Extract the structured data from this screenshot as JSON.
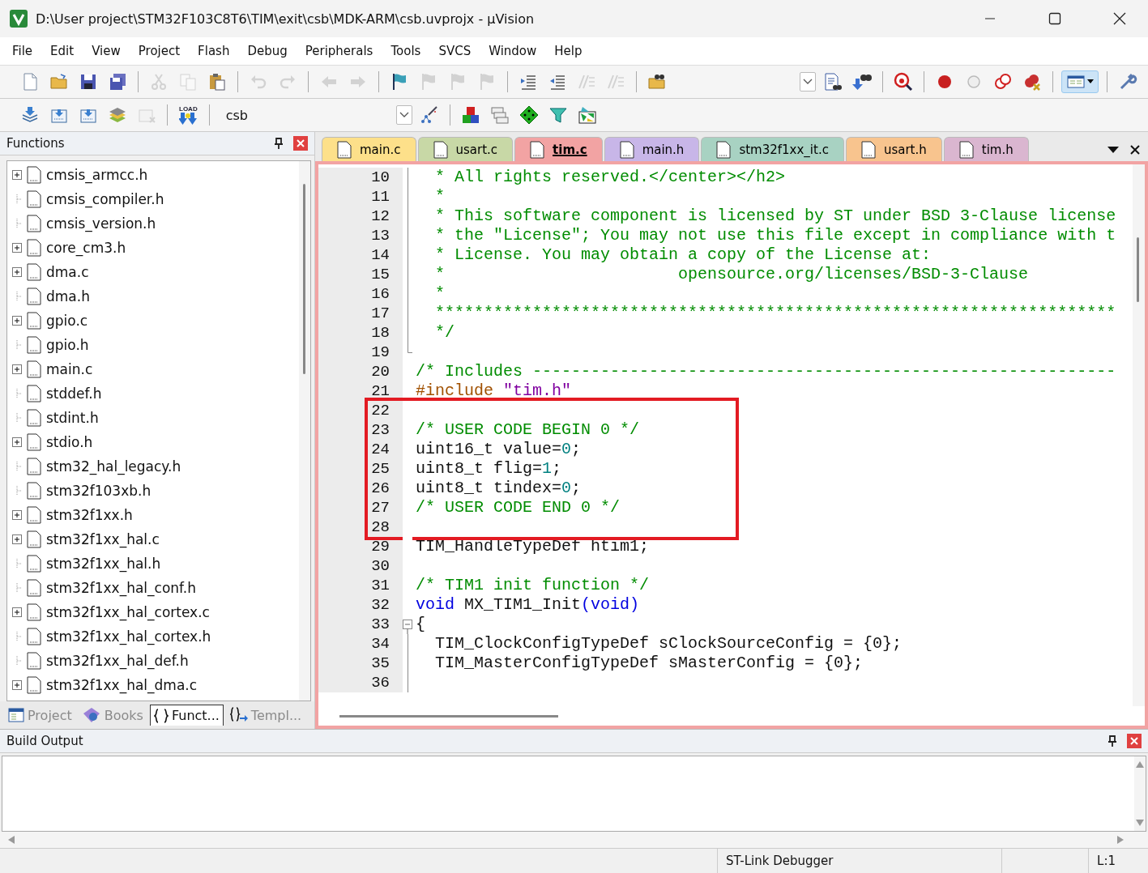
{
  "window": {
    "title": "D:\\User project\\STM32F103C8T6\\TIM\\exit\\csb\\MDK-ARM\\csb.uvprojx - µVision"
  },
  "menu": [
    "File",
    "Edit",
    "View",
    "Project",
    "Flash",
    "Debug",
    "Peripherals",
    "Tools",
    "SVCS",
    "Window",
    "Help"
  ],
  "toolbar_1": [
    {
      "kind": "new",
      "disabled": false
    },
    {
      "kind": "open",
      "disabled": false
    },
    {
      "kind": "save",
      "disabled": false
    },
    {
      "kind": "save-all",
      "disabled": false
    },
    {
      "kind": "separator"
    },
    {
      "kind": "cut",
      "disabled": true
    },
    {
      "kind": "copy",
      "disabled": true
    },
    {
      "kind": "paste",
      "disabled": false
    },
    {
      "kind": "separator"
    },
    {
      "kind": "undo",
      "disabled": true
    },
    {
      "kind": "redo",
      "disabled": true
    },
    {
      "kind": "separator"
    },
    {
      "kind": "back",
      "disabled": true
    },
    {
      "kind": "forward",
      "disabled": true
    },
    {
      "kind": "separator"
    },
    {
      "kind": "bookmark",
      "disabled": false
    },
    {
      "kind": "bookmark-prev",
      "disabled": true
    },
    {
      "kind": "bookmark-next",
      "disabled": true
    },
    {
      "kind": "bookmark-clear",
      "disabled": true
    },
    {
      "kind": "separator"
    },
    {
      "kind": "indent",
      "disabled": false
    },
    {
      "kind": "unindent",
      "disabled": false
    },
    {
      "kind": "comment",
      "disabled": true
    },
    {
      "kind": "uncomment",
      "disabled": true
    },
    {
      "kind": "separator"
    },
    {
      "kind": "find-in-files",
      "disabled": false
    },
    {
      "kind": "spacer"
    },
    {
      "kind": "combo"
    },
    {
      "kind": "find",
      "disabled": false
    },
    {
      "kind": "incremental-find",
      "disabled": false
    },
    {
      "kind": "separator"
    },
    {
      "kind": "debug",
      "disabled": false
    },
    {
      "kind": "separator"
    },
    {
      "kind": "breakpoint",
      "disabled": false
    },
    {
      "kind": "breakpoint-off",
      "disabled": false
    },
    {
      "kind": "breakpoints",
      "disabled": false
    },
    {
      "kind": "breakpoints-kill",
      "disabled": false
    },
    {
      "kind": "separator"
    },
    {
      "kind": "layout"
    },
    {
      "kind": "separator"
    },
    {
      "kind": "wrench",
      "disabled": false
    }
  ],
  "toolbar_2": [
    {
      "kind": "translate",
      "disabled": false
    },
    {
      "kind": "build",
      "disabled": false
    },
    {
      "kind": "rebuild",
      "disabled": false
    },
    {
      "kind": "batch",
      "disabled": false
    },
    {
      "kind": "stop",
      "disabled": true
    },
    {
      "kind": "separator"
    },
    {
      "kind": "load",
      "label": "LOAD"
    },
    {
      "kind": "separator"
    },
    {
      "kind": "target",
      "value": "csb"
    },
    {
      "kind": "options",
      "disabled": false
    },
    {
      "kind": "separator"
    },
    {
      "kind": "components",
      "disabled": false
    },
    {
      "kind": "multi-project",
      "disabled": false
    },
    {
      "kind": "diamond",
      "disabled": false
    },
    {
      "kind": "funnel",
      "disabled": false
    },
    {
      "kind": "packs",
      "disabled": false
    }
  ],
  "functions_panel": {
    "title": "Functions",
    "items": [
      {
        "label": "cmsis_armcc.h",
        "kind": "collapsed"
      },
      {
        "label": "cmsis_compiler.h",
        "kind": "leaf"
      },
      {
        "label": "cmsis_version.h",
        "kind": "leaf"
      },
      {
        "label": "core_cm3.h",
        "kind": "collapsed"
      },
      {
        "label": "dma.c",
        "kind": "collapsed"
      },
      {
        "label": "dma.h",
        "kind": "leaf"
      },
      {
        "label": "gpio.c",
        "kind": "collapsed"
      },
      {
        "label": "gpio.h",
        "kind": "leaf"
      },
      {
        "label": "main.c",
        "kind": "collapsed"
      },
      {
        "label": "stddef.h",
        "kind": "leaf"
      },
      {
        "label": "stdint.h",
        "kind": "leaf"
      },
      {
        "label": "stdio.h",
        "kind": "collapsed"
      },
      {
        "label": "stm32_hal_legacy.h",
        "kind": "leaf"
      },
      {
        "label": "stm32f103xb.h",
        "kind": "leaf"
      },
      {
        "label": "stm32f1xx.h",
        "kind": "collapsed"
      },
      {
        "label": "stm32f1xx_hal.c",
        "kind": "collapsed"
      },
      {
        "label": "stm32f1xx_hal.h",
        "kind": "leaf"
      },
      {
        "label": "stm32f1xx_hal_conf.h",
        "kind": "leaf"
      },
      {
        "label": "stm32f1xx_hal_cortex.c",
        "kind": "collapsed"
      },
      {
        "label": "stm32f1xx_hal_cortex.h",
        "kind": "leaf"
      },
      {
        "label": "stm32f1xx_hal_def.h",
        "kind": "leaf"
      },
      {
        "label": "stm32f1xx_hal_dma.c",
        "kind": "collapsed"
      }
    ],
    "tabs": [
      {
        "label": "Project",
        "kind": "project",
        "selected": false
      },
      {
        "label": "Books",
        "kind": "books",
        "selected": false
      },
      {
        "label": "Funct...",
        "kind": "functions",
        "selected": true
      },
      {
        "label": "Templ...",
        "kind": "templates",
        "selected": false
      }
    ]
  },
  "editor": {
    "tabs": [
      {
        "label": "main.c",
        "color": "#fde08a",
        "selected": false
      },
      {
        "label": "usart.c",
        "color": "#c8d8a6",
        "selected": false
      },
      {
        "label": "tim.c",
        "color": "#f2a3a3",
        "selected": true
      },
      {
        "label": "main.h",
        "color": "#c8b6e8",
        "selected": false
      },
      {
        "label": "stm32f1xx_it.c",
        "color": "#a8d2c2",
        "selected": false
      },
      {
        "label": "usart.h",
        "color": "#f8c48e",
        "selected": false
      },
      {
        "label": "tim.h",
        "color": "#dab6d0",
        "selected": false
      }
    ],
    "lines": [
      {
        "number": "10",
        "kind": "fold-body",
        "boxed": false,
        "segments": [
          {
            "kind": "comment",
            "text": "  * All rights reserved.</center></h2>"
          }
        ]
      },
      {
        "number": "11",
        "kind": "fold-body",
        "boxed": false,
        "segments": [
          {
            "kind": "comment",
            "text": "  *"
          }
        ]
      },
      {
        "number": "12",
        "kind": "fold-body",
        "boxed": false,
        "segments": [
          {
            "kind": "comment",
            "text": "  * This software component is licensed by ST under BSD 3-Clause license"
          }
        ]
      },
      {
        "number": "13",
        "kind": "fold-body",
        "boxed": false,
        "segments": [
          {
            "kind": "comment",
            "text": "  * the \"License\"; You may not use this file except in compliance with t"
          }
        ]
      },
      {
        "number": "14",
        "kind": "fold-body",
        "boxed": false,
        "segments": [
          {
            "kind": "comment",
            "text": "  * License. You may obtain a copy of the License at:"
          }
        ]
      },
      {
        "number": "15",
        "kind": "fold-body",
        "boxed": false,
        "segments": [
          {
            "kind": "comment",
            "text": "  *                        opensource.org/licenses/BSD-3-Clause"
          }
        ]
      },
      {
        "number": "16",
        "kind": "fold-body",
        "boxed": false,
        "segments": [
          {
            "kind": "comment",
            "text": "  *"
          }
        ]
      },
      {
        "number": "17",
        "kind": "fold-body",
        "boxed": false,
        "segments": [
          {
            "kind": "comment",
            "text": "  **********************************************************************"
          }
        ]
      },
      {
        "number": "18",
        "kind": "fold-body",
        "boxed": false,
        "segments": [
          {
            "kind": "comment",
            "text": "  */"
          }
        ]
      },
      {
        "number": "19",
        "kind": "fold-end",
        "boxed": false
      },
      {
        "number": "20",
        "kind": "plain",
        "boxed": false,
        "segments": [
          {
            "kind": "comment",
            "text": "/* Includes ------------------------------------------------------------"
          }
        ]
      },
      {
        "number": "21",
        "kind": "plain",
        "boxed": false,
        "segments": [
          {
            "kind": "preprocessor",
            "text": "#include "
          },
          {
            "kind": "string",
            "text": "\"tim.h\""
          }
        ]
      },
      {
        "number": "22",
        "kind": "plain",
        "boxed": true
      },
      {
        "number": "23",
        "kind": "plain",
        "boxed": true,
        "segments": [
          {
            "kind": "comment",
            "text": "/* USER CODE BEGIN 0 */"
          }
        ]
      },
      {
        "number": "24",
        "kind": "plain",
        "boxed": true,
        "segments": [
          {
            "kind": "plain",
            "text": "uint16_t value="
          },
          {
            "kind": "number",
            "text": "0"
          },
          {
            "kind": "plain",
            "text": ";"
          }
        ]
      },
      {
        "number": "25",
        "kind": "plain",
        "boxed": true,
        "segments": [
          {
            "kind": "plain",
            "text": "uint8_t flig="
          },
          {
            "kind": "number",
            "text": "1"
          },
          {
            "kind": "plain",
            "text": ";"
          }
        ]
      },
      {
        "number": "26",
        "kind": "plain",
        "boxed": true,
        "segments": [
          {
            "kind": "plain",
            "text": "uint8_t tindex="
          },
          {
            "kind": "number",
            "text": "0"
          },
          {
            "kind": "plain",
            "text": ";"
          }
        ]
      },
      {
        "number": "27",
        "kind": "plain",
        "boxed": true,
        "segments": [
          {
            "kind": "comment",
            "text": "/* USER CODE END 0 */"
          }
        ]
      },
      {
        "number": "28",
        "kind": "plain",
        "boxed": true
      },
      {
        "number": "29",
        "kind": "plain",
        "boxed": false,
        "segments": [
          {
            "kind": "plain",
            "text": "TIM_HandleTypeDef htim1;"
          }
        ]
      },
      {
        "number": "30",
        "kind": "plain",
        "boxed": false
      },
      {
        "number": "31",
        "kind": "plain",
        "boxed": false,
        "segments": [
          {
            "kind": "comment",
            "text": "/* TIM1 init function */"
          }
        ]
      },
      {
        "number": "32",
        "kind": "plain",
        "boxed": false,
        "segments": [
          {
            "kind": "keyword",
            "text": "void"
          },
          {
            "kind": "plain",
            "text": " MX_TIM1_Init"
          },
          {
            "kind": "keyword",
            "text": "(void)"
          }
        ]
      },
      {
        "number": "33",
        "kind": "fold-start",
        "boxed": false,
        "segments": [
          {
            "kind": "plain",
            "text": "{"
          }
        ]
      },
      {
        "number": "34",
        "kind": "fold-body",
        "boxed": false,
        "segments": [
          {
            "kind": "plain",
            "text": "  TIM_ClockConfigTypeDef sClockSourceConfig = {0};"
          }
        ]
      },
      {
        "number": "35",
        "kind": "fold-body",
        "boxed": false,
        "segments": [
          {
            "kind": "plain",
            "text": "  TIM_MasterConfigTypeDef sMasterConfig = {0};"
          }
        ]
      },
      {
        "number": "36",
        "kind": "fold-body",
        "boxed": false
      }
    ]
  },
  "build_output": {
    "title": "Build Output"
  },
  "status_bar": [
    "ST-Link Debugger",
    "L:1"
  ]
}
